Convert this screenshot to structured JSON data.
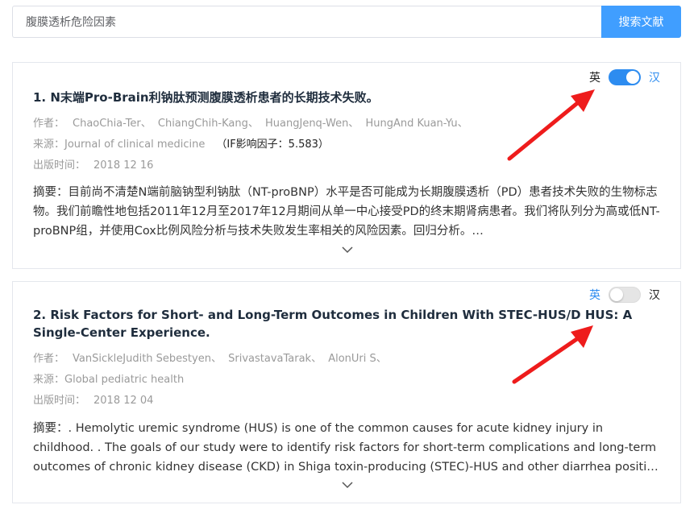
{
  "search": {
    "value": "腹膜透析危险因素",
    "button_label": "搜索文献"
  },
  "toggle_labels": {
    "en": "英",
    "zh": "汉"
  },
  "articles": [
    {
      "title": "1. N末端Pro-Brain利钠肽预测腹膜透析患者的长期技术失败。",
      "lang_state": "zh",
      "authors_label": "作者：",
      "authors": [
        "ChaoChia-Ter、",
        "ChiangChih-Kang、",
        "HuangJenq-Wen、",
        "HungAnd Kuan-Yu、"
      ],
      "source_label": "来源：",
      "source": "Journal of clinical medicine",
      "impact_factor": "（IF影响因子：5.583）",
      "date_label": "出版时间：",
      "date": "2018 12 16",
      "abstract": "摘要：目前尚不清楚N端前脑钠型利钠肽（NT-proBNP）水平是否可能成为长期腹膜透析（PD）患者技术失败的生物标志物。我们前瞻性地包括2011年12月至2017年12月期间从单一中心接受PD的终末期肾病患者。我们将队列分为高或低NT-proBNP组，并使用Cox比例风险分析与技术失败发生率相关的风险因素。回归分析。…"
    },
    {
      "title": "2. Risk Factors for Short- and Long-Term Outcomes in Children With STEC-HUS/D HUS: A Single-Center Experience.",
      "lang_state": "en",
      "authors_label": "作者：",
      "authors": [
        "VanSickleJudith Sebestyen、",
        "SrivastavaTarak、",
        "AlonUri S、"
      ],
      "source_label": "来源：",
      "source": "Global pediatric health",
      "date_label": "出版时间：",
      "date": "2018 12 04",
      "abstract": "摘要：. Hemolytic uremic syndrome (HUS) is one of the common causes for acute kidney injury in childhood. . The goals of our study were to identify risk factors for short-term complications and long-term outcomes of chronic kidney disease (CKD) in Shiga toxin-producing (STEC)-HUS and other diarrhea positive (D) HUS. …."
    }
  ],
  "colors": {
    "accent": "#409eff",
    "switch_on": "#2d8cf0",
    "annotation_arrow": "#ee1c1c"
  },
  "icons": {
    "expand": "chevron-down-icon",
    "annotation": "red-arrow-icon"
  }
}
